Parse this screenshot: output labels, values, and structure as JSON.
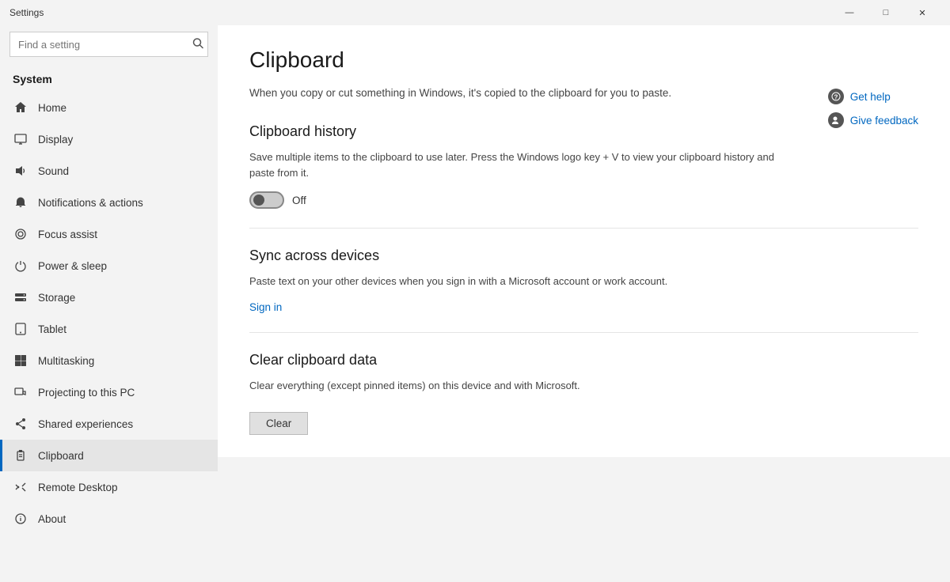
{
  "titleBar": {
    "appTitle": "Settings",
    "minBtn": "—",
    "maxBtn": "□",
    "closeBtn": "✕"
  },
  "sidebar": {
    "sectionTitle": "System",
    "searchPlaceholder": "Find a setting",
    "searchIcon": "🔍",
    "navItems": [
      {
        "id": "home",
        "label": "Home",
        "icon": "home"
      },
      {
        "id": "display",
        "label": "Display",
        "icon": "display"
      },
      {
        "id": "sound",
        "label": "Sound",
        "icon": "sound"
      },
      {
        "id": "notifications",
        "label": "Notifications & actions",
        "icon": "notifications"
      },
      {
        "id": "focus",
        "label": "Focus assist",
        "icon": "focus"
      },
      {
        "id": "power",
        "label": "Power & sleep",
        "icon": "power"
      },
      {
        "id": "storage",
        "label": "Storage",
        "icon": "storage"
      },
      {
        "id": "tablet",
        "label": "Tablet",
        "icon": "tablet"
      },
      {
        "id": "multitasking",
        "label": "Multitasking",
        "icon": "multitasking"
      },
      {
        "id": "projecting",
        "label": "Projecting to this PC",
        "icon": "projecting"
      },
      {
        "id": "shared",
        "label": "Shared experiences",
        "icon": "shared"
      },
      {
        "id": "clipboard",
        "label": "Clipboard",
        "icon": "clipboard",
        "active": true
      },
      {
        "id": "remote",
        "label": "Remote Desktop",
        "icon": "remote"
      },
      {
        "id": "about",
        "label": "About",
        "icon": "about"
      }
    ]
  },
  "main": {
    "pageTitle": "Clipboard",
    "pageDescription": "When you copy or cut something in Windows, it's copied to the clipboard for you to paste.",
    "helpLinks": [
      {
        "label": "Get help",
        "icon": "help"
      },
      {
        "label": "Give feedback",
        "icon": "feedback"
      }
    ],
    "sections": [
      {
        "id": "history",
        "title": "Clipboard history",
        "description": "Save multiple items to the clipboard to use later. Press the Windows logo key + V to view your clipboard history and paste from it.",
        "toggle": {
          "state": "Off"
        }
      },
      {
        "id": "sync",
        "title": "Sync across devices",
        "description": "Paste text on your other devices when you sign in with a Microsoft account or work account.",
        "signInLabel": "Sign in"
      },
      {
        "id": "clear",
        "title": "Clear clipboard data",
        "description": "Clear everything (except pinned items) on this device and with Microsoft.",
        "clearButtonLabel": "Clear"
      }
    ]
  }
}
